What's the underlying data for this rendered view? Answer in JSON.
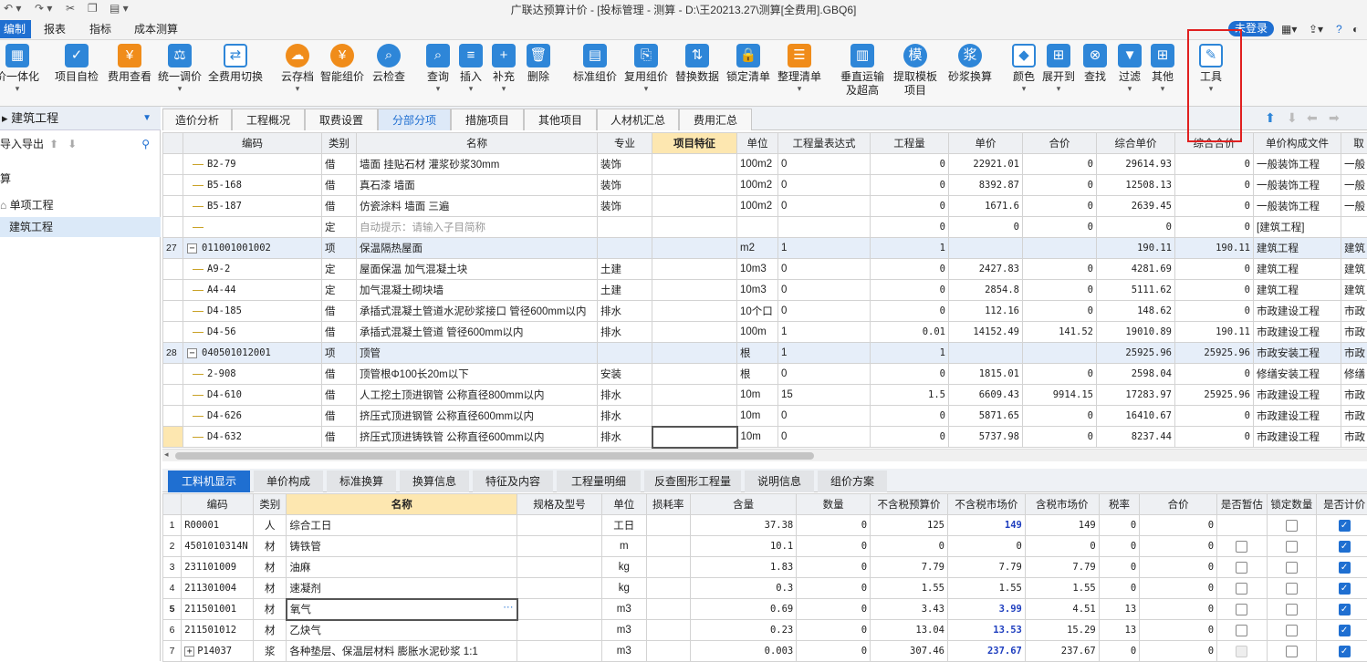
{
  "titlebar": {
    "title": "广联达预算计价 - [投标管理 - 测算 - D:\\王20213.27\\测算[全费用].GBQ6]"
  },
  "menu": {
    "items": [
      "编制",
      "报表",
      "指标",
      "成本测算"
    ],
    "login": "未登录"
  },
  "toolbar": {
    "items": [
      "价一体化",
      "项目自检",
      "费用查看",
      "统一调价",
      "全费用切换",
      "云存档",
      "智能组价",
      "云检查",
      "查询",
      "插入",
      "补充",
      "删除",
      "标准组价",
      "复用组价",
      "替换数据",
      "锁定清单",
      "整理清单",
      "垂直运输",
      "及超高",
      "提取模板",
      "项目",
      "砂浆换算",
      "颜色",
      "展开到",
      "查找",
      "过滤",
      "其他",
      "工具"
    ]
  },
  "left": {
    "header": "建筑工程",
    "io": "导入导出",
    "tree": [
      "算",
      "单项工程",
      "建筑工程"
    ]
  },
  "tabs1": [
    "造价分析",
    "工程概况",
    "取费设置",
    "分部分项",
    "措施项目",
    "其他项目",
    "人材机汇总",
    "费用汇总"
  ],
  "grid1": {
    "headers": [
      "编码",
      "类别",
      "名称",
      "专业",
      "项目特征",
      "单位",
      "工程量表达式",
      "工程量",
      "单价",
      "合价",
      "综合单价",
      "综合合价",
      "单价构成文件",
      "取"
    ],
    "rows": [
      [
        "",
        "B2-79",
        "借",
        "墙面 挂贴石材 灌浆砂浆30mm",
        "装饰",
        "",
        "100m2",
        "0",
        "0",
        "22921.01",
        "0",
        "29614.93",
        "0",
        "一般装饰工程",
        "一般"
      ],
      [
        "",
        "B5-168",
        "借",
        "真石漆 墙面",
        "装饰",
        "",
        "100m2",
        "0",
        "0",
        "8392.87",
        "0",
        "12508.13",
        "0",
        "一般装饰工程",
        "一般"
      ],
      [
        "",
        "B5-187",
        "借",
        "仿瓷涂料 墙面 三遍",
        "装饰",
        "",
        "100m2",
        "0",
        "0",
        "1671.6",
        "0",
        "2639.45",
        "0",
        "一般装饰工程",
        "一般"
      ],
      [
        "",
        "",
        "定",
        "自动提示：请输入子目简称",
        "",
        "",
        "",
        "",
        "0",
        "0",
        "0",
        "0",
        "0",
        "[建筑工程]",
        ""
      ],
      [
        "27",
        "011001001002",
        "项",
        "保温隔热屋面",
        "",
        "",
        "m2",
        "1",
        "1",
        "",
        "",
        "190.11",
        "190.11",
        "建筑工程",
        "建筑"
      ],
      [
        "",
        "A9-2",
        "定",
        "屋面保温 加气混凝土块",
        "土建",
        "",
        "10m3",
        "0",
        "0",
        "2427.83",
        "0",
        "4281.69",
        "0",
        "建筑工程",
        "建筑"
      ],
      [
        "",
        "A4-44",
        "定",
        "加气混凝土砌块墙",
        "土建",
        "",
        "10m3",
        "0",
        "0",
        "2854.8",
        "0",
        "5111.62",
        "0",
        "建筑工程",
        "建筑"
      ],
      [
        "",
        "D4-185",
        "借",
        "承插式混凝土管道水泥砂浆接口 管径600mm以内",
        "排水",
        "",
        "10个口",
        "0",
        "0",
        "112.16",
        "0",
        "148.62",
        "0",
        "市政建设工程",
        "市政"
      ],
      [
        "",
        "D4-56",
        "借",
        "承插式混凝土管道 管径600mm以内",
        "排水",
        "",
        "100m",
        "1",
        "0.01",
        "14152.49",
        "141.52",
        "19010.89",
        "190.11",
        "市政建设工程",
        "市政"
      ],
      [
        "28",
        "040501012001",
        "项",
        "顶管",
        "",
        "",
        "根",
        "1",
        "1",
        "",
        "",
        "25925.96",
        "25925.96",
        "市政安装工程",
        "市政"
      ],
      [
        "",
        "2-908",
        "借",
        "顶管根Φ100长20m以下",
        "安装",
        "",
        "根",
        "0",
        "0",
        "1815.01",
        "0",
        "2598.04",
        "0",
        "修缮安装工程",
        "修缮"
      ],
      [
        "",
        "D4-610",
        "借",
        "人工挖土顶进钢管 公称直径800mm以内",
        "排水",
        "",
        "10m",
        "15",
        "1.5",
        "6609.43",
        "9914.15",
        "17283.97",
        "25925.96",
        "市政建设工程",
        "市政"
      ],
      [
        "",
        "D4-626",
        "借",
        "挤压式顶进钢管 公称直径600mm以内",
        "排水",
        "",
        "10m",
        "0",
        "0",
        "5871.65",
        "0",
        "16410.67",
        "0",
        "市政建设工程",
        "市政"
      ],
      [
        "",
        "D4-632",
        "借",
        "挤压式顶进铸铁管 公称直径600mm以内",
        "排水",
        "",
        "10m",
        "0",
        "0",
        "5737.98",
        "0",
        "8237.44",
        "0",
        "市政建设工程",
        "市政"
      ]
    ]
  },
  "tabs2": [
    "工料机显示",
    "单价构成",
    "标准换算",
    "换算信息",
    "特征及内容",
    "工程量明细",
    "反查图形工程量",
    "说明信息",
    "组价方案"
  ],
  "grid2": {
    "headers": [
      "编码",
      "类别",
      "名称",
      "规格及型号",
      "单位",
      "损耗率",
      "含量",
      "数量",
      "不含税预算价",
      "不含税市场价",
      "含税市场价",
      "税率",
      "合价",
      "是否暂估",
      "锁定数量",
      "是否计价"
    ],
    "rows": [
      [
        "1",
        "R00001",
        "人",
        "综合工日",
        "",
        "工日",
        "",
        "37.38",
        "0",
        "125",
        "149",
        "149",
        "0",
        "0"
      ],
      [
        "2",
        "4501010314N",
        "材",
        "铸铁管",
        "",
        "m",
        "",
        "10.1",
        "0",
        "0",
        "0",
        "0",
        "0",
        "0"
      ],
      [
        "3",
        "231101009",
        "材",
        "油麻",
        "",
        "kg",
        "",
        "1.83",
        "0",
        "7.79",
        "7.79",
        "7.79",
        "0",
        "0"
      ],
      [
        "4",
        "211301004",
        "材",
        "速凝剂",
        "",
        "kg",
        "",
        "0.3",
        "0",
        "1.55",
        "1.55",
        "1.55",
        "0",
        "0"
      ],
      [
        "5",
        "211501001",
        "材",
        "氧气",
        "",
        "m3",
        "",
        "0.69",
        "0",
        "3.43",
        "3.99",
        "4.51",
        "13",
        "0"
      ],
      [
        "6",
        "211501012",
        "材",
        "乙炔气",
        "",
        "m3",
        "",
        "0.23",
        "0",
        "13.04",
        "13.53",
        "15.29",
        "13",
        "0"
      ],
      [
        "7",
        "P14037",
        "浆",
        "各种垫层、保温层材料 膨胀水泥砂浆 1:1",
        "",
        "m3",
        "",
        "0.003",
        "0",
        "307.46",
        "237.67",
        "237.67",
        "0",
        "0"
      ]
    ]
  }
}
